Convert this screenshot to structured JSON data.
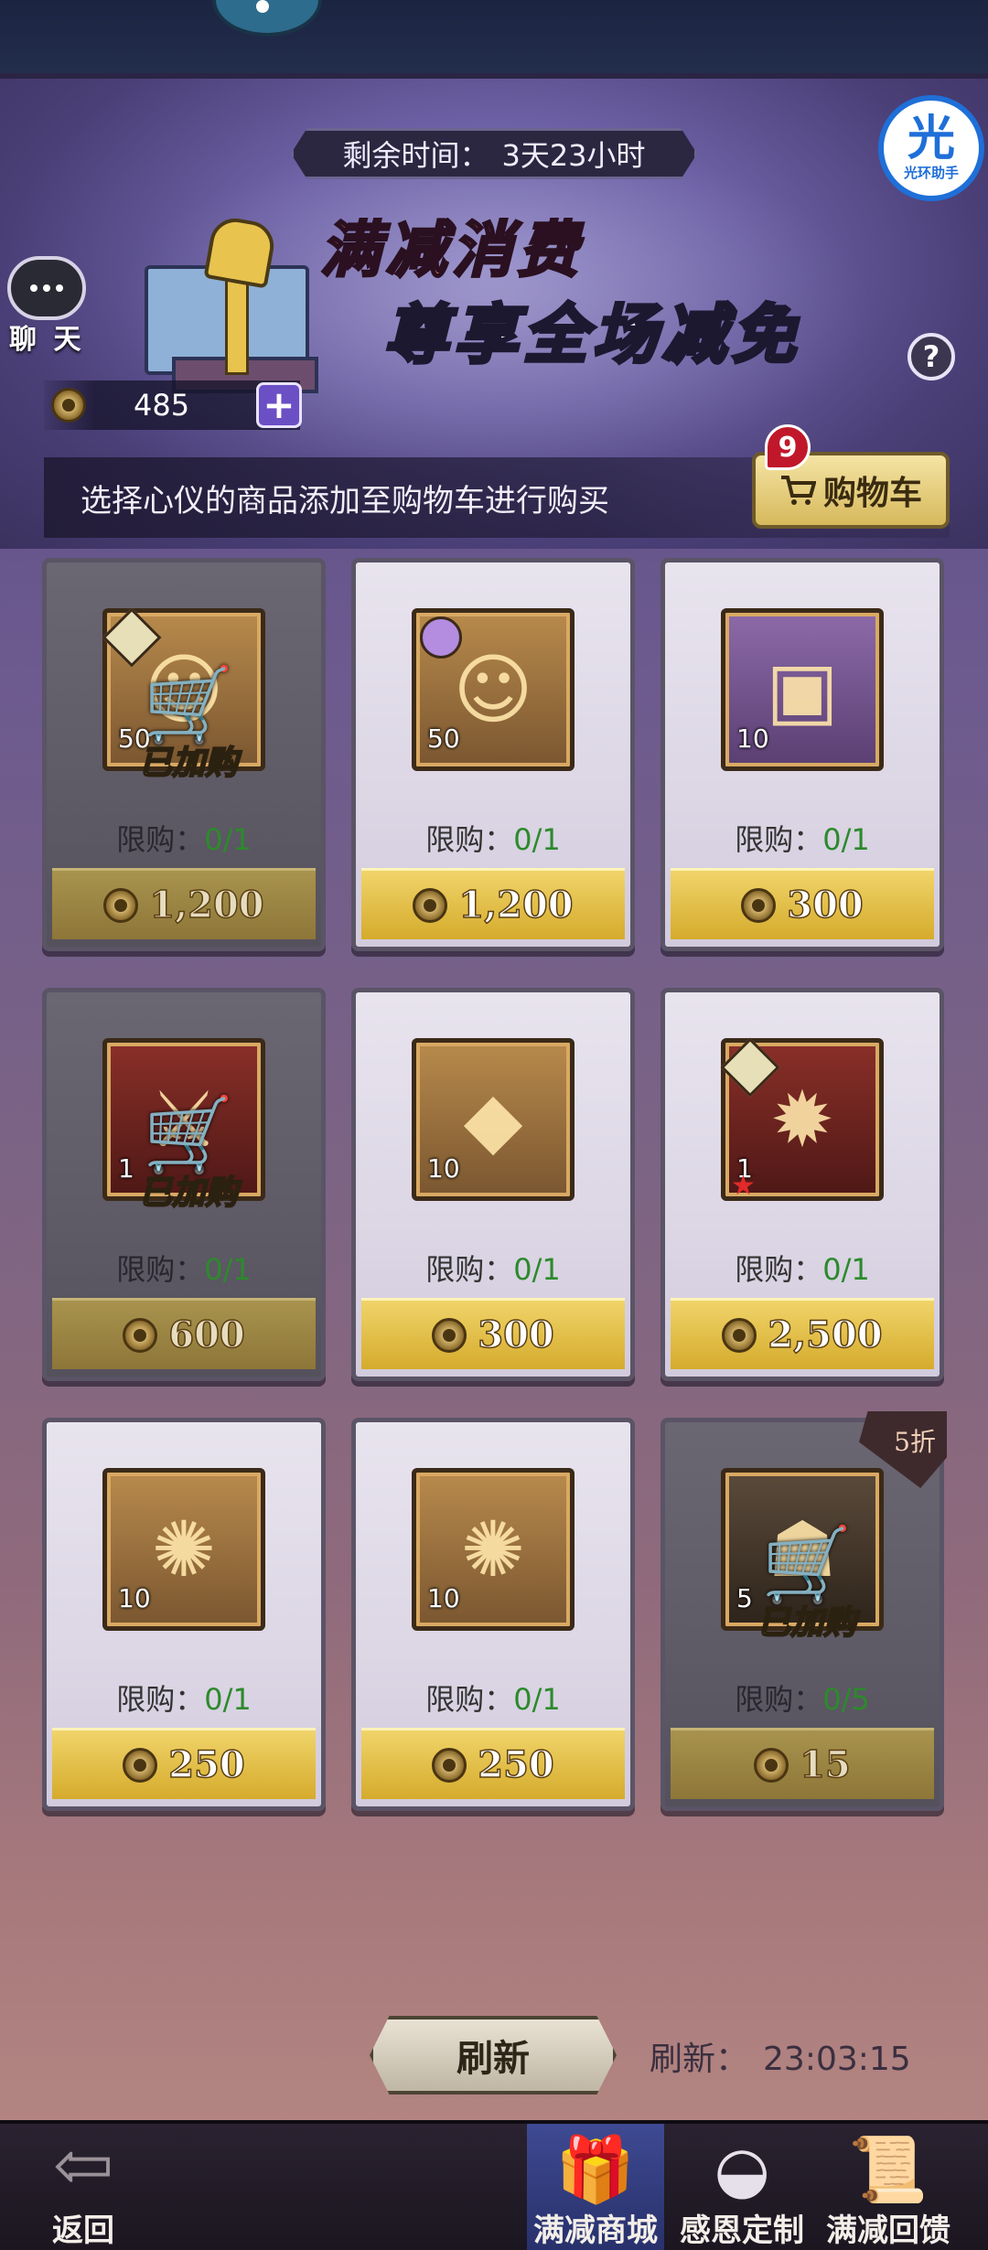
{
  "header": {
    "timer_label": "剩余时间：",
    "timer_value": "3天23小时",
    "helper_glyph": "光",
    "helper_label": "光环助手",
    "chat_label": "聊 天",
    "title_line1": "满减消费",
    "title_line2": "尊享全场减免",
    "help_glyph": "?"
  },
  "currency": {
    "amount": "485",
    "plus": "+"
  },
  "hint": "选择心仪的商品添加至购物车进行购买",
  "cart": {
    "label": "购物车",
    "count": "9"
  },
  "items": [
    {
      "qty": "50",
      "limit_label": "限购：",
      "limit": "0/1",
      "price": "1,200",
      "added": true,
      "added_label": "已加购"
    },
    {
      "qty": "50",
      "limit_label": "限购：",
      "limit": "0/1",
      "price": "1,200",
      "added": false
    },
    {
      "qty": "10",
      "limit_label": "限购：",
      "limit": "0/1",
      "price": "300",
      "added": false
    },
    {
      "qty": "1",
      "limit_label": "限购：",
      "limit": "0/1",
      "price": "600",
      "added": true,
      "added_label": "已加购"
    },
    {
      "qty": "10",
      "limit_label": "限购：",
      "limit": "0/1",
      "price": "300",
      "added": false
    },
    {
      "qty": "1",
      "limit_label": "限购：",
      "limit": "0/1",
      "price": "2,500",
      "added": false
    },
    {
      "qty": "10",
      "limit_label": "限购：",
      "limit": "0/1",
      "price": "250",
      "added": false
    },
    {
      "qty": "10",
      "limit_label": "限购：",
      "limit": "0/1",
      "price": "250",
      "added": false
    },
    {
      "qty": "5",
      "limit_label": "限购：",
      "limit": "0/5",
      "price": "15",
      "added": true,
      "added_label": "已加购",
      "discount": "5折"
    }
  ],
  "refresh": {
    "button": "刷新",
    "label": "刷新：",
    "time": "23:03:15"
  },
  "nav": {
    "back": "返回",
    "tab1": "满减商城",
    "tab2": "感恩定制",
    "tab3": "满减回馈"
  },
  "colors": {
    "limit_value": "#2c8a2c",
    "price_gold": "#d5ab2c",
    "active_tab": "#3e4a92"
  }
}
